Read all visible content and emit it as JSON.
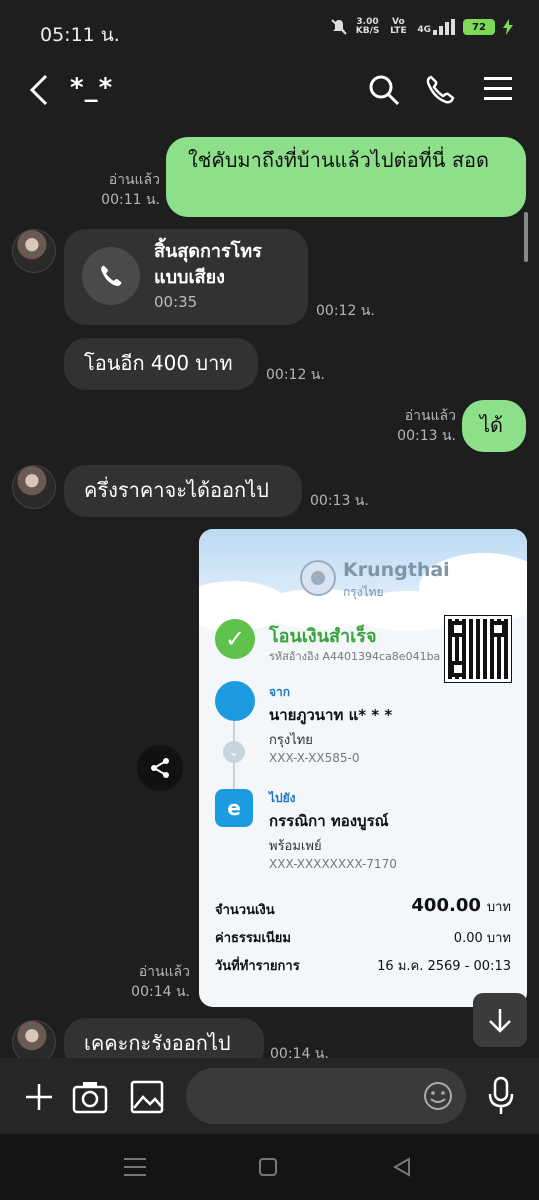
{
  "status": {
    "time": "05:11 น.",
    "net_speed": "3.00",
    "net_unit": "KB/S",
    "volte": "Vo LTE",
    "signal": "4G",
    "battery": "72"
  },
  "header": {
    "title": "*_*"
  },
  "messages": [
    {
      "side": "me",
      "text": "ใช่คับมาถึงที่บ้านแล้วไปต่อที่นี่ สอด",
      "read": "อ่านแล้ว",
      "time": "00:11 น."
    },
    {
      "side": "other",
      "call_title": "สิ้นสุดการโทรแบบเสียง",
      "call_duration": "00:35",
      "time": "00:12 น."
    },
    {
      "side": "other",
      "text": "โอนอีก 400 บาท",
      "time": "00:12 น."
    },
    {
      "side": "me",
      "text": "ได้",
      "read": "อ่านแล้ว",
      "time": "00:13 น."
    },
    {
      "side": "other",
      "text": "ครึ่งราคาจะได้ออกไป",
      "time": "00:13 น."
    },
    {
      "side": "me",
      "read": "อ่านแล้ว",
      "time": "00:14 น."
    },
    {
      "side": "other",
      "text": "เคคะกะรังออกไป",
      "time": "00:14 น."
    }
  ],
  "slip": {
    "bank_name": "Krungthai",
    "bank_name_th": "กรุงไทย",
    "status": "โอนเงินสำเร็จ",
    "ref": "รหัสอ้างอิง A4401394ca8e041ba",
    "from_label": "จาก",
    "from_name": "นายภูวนาท แ* * *",
    "from_bank": "กรุงไทย",
    "from_acct": "XXX-X-XX585-0",
    "to_label": "ไปยัง",
    "to_name": "กรรณิกา ทองบูรณ์",
    "to_bank": "พร้อมเพย์",
    "to_acct": "XXX-XXXXXXXX-7170",
    "amount_label": "จำนวนเงิน",
    "amount": "400.00",
    "amount_unit": "บาท",
    "fee_label": "ค่าธรรมเนียม",
    "fee": "0.00 บาท",
    "date_label": "วันที่ทำรายการ",
    "date": "16 ม.ค. 2569 - 00:13"
  },
  "colors": {
    "accent_green": "#8de08a",
    "bubble_other": "#323232",
    "background": "#1e1e1e",
    "success": "#5ec24a",
    "bank_blue": "#1b78c7"
  },
  "icons": [
    "back-icon",
    "search-icon",
    "phone-icon",
    "menu-icon",
    "share-icon",
    "scroll-down-icon",
    "add-icon",
    "camera-icon",
    "image-icon",
    "emoji-icon",
    "mic-icon"
  ]
}
